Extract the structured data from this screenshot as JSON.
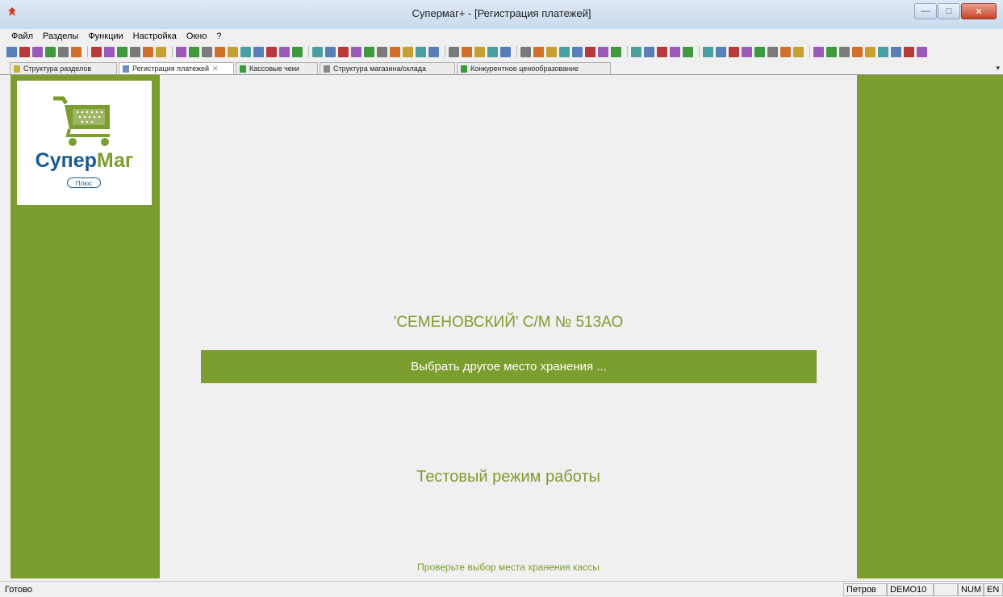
{
  "window": {
    "title": "Супермаг+  - [Регистрация платежей]"
  },
  "menu": [
    {
      "label": "Файл"
    },
    {
      "label": "Разделы"
    },
    {
      "label": "Функции"
    },
    {
      "label": "Настройка"
    },
    {
      "label": "Окно"
    },
    {
      "label": "?"
    }
  ],
  "tabs": [
    {
      "label": "Структура разделов"
    },
    {
      "label": "Регистрация платежей"
    },
    {
      "label": "Кассовые чеки"
    },
    {
      "label": "Структура магазина/склада"
    },
    {
      "label": "Конкурентное ценообразование"
    }
  ],
  "logo": {
    "brand_part1": "Супер",
    "brand_part2": "Маг",
    "badge": "Плюс"
  },
  "main": {
    "store_name": "'СЕМЕНОВСКИЙ' С/М № 513АО",
    "choose_button": "Выбрать другое место хранения ...",
    "test_mode": "Тестовый режим работы",
    "hint": "Проверьте выбор места хранения кассы"
  },
  "status": {
    "text": "Готово",
    "user": "Петров",
    "database": "DEMO10",
    "num": "NUM",
    "lang": "EN"
  },
  "colors": {
    "accent_green": "#7b9e2f",
    "logo_blue": "#1a5a8c"
  }
}
